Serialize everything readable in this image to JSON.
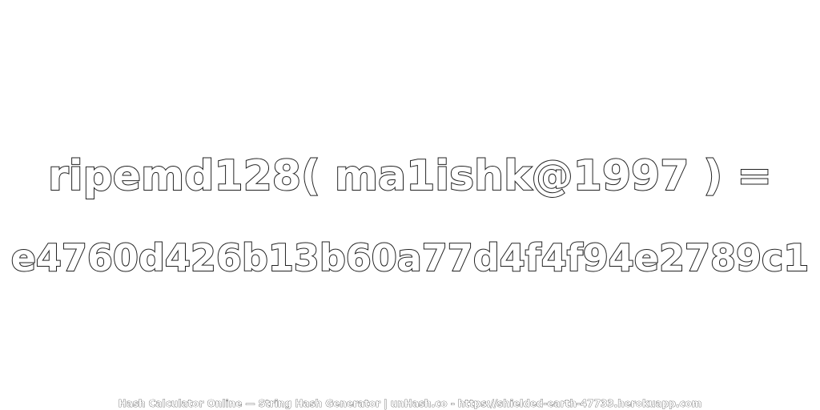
{
  "expression": "ripemd128( ma1ishk@1997 ) =",
  "hash_result": "e4760d426b13b60a77d4f4f94e2789c1",
  "footer": "Hash Calculator Online — String Hash Generator | unHash.co - https://shielded-earth-47733.herokuapp.com",
  "colors": {
    "background": "#ffffff",
    "text_fill": "#ffffff",
    "text_outline": "#222222"
  }
}
